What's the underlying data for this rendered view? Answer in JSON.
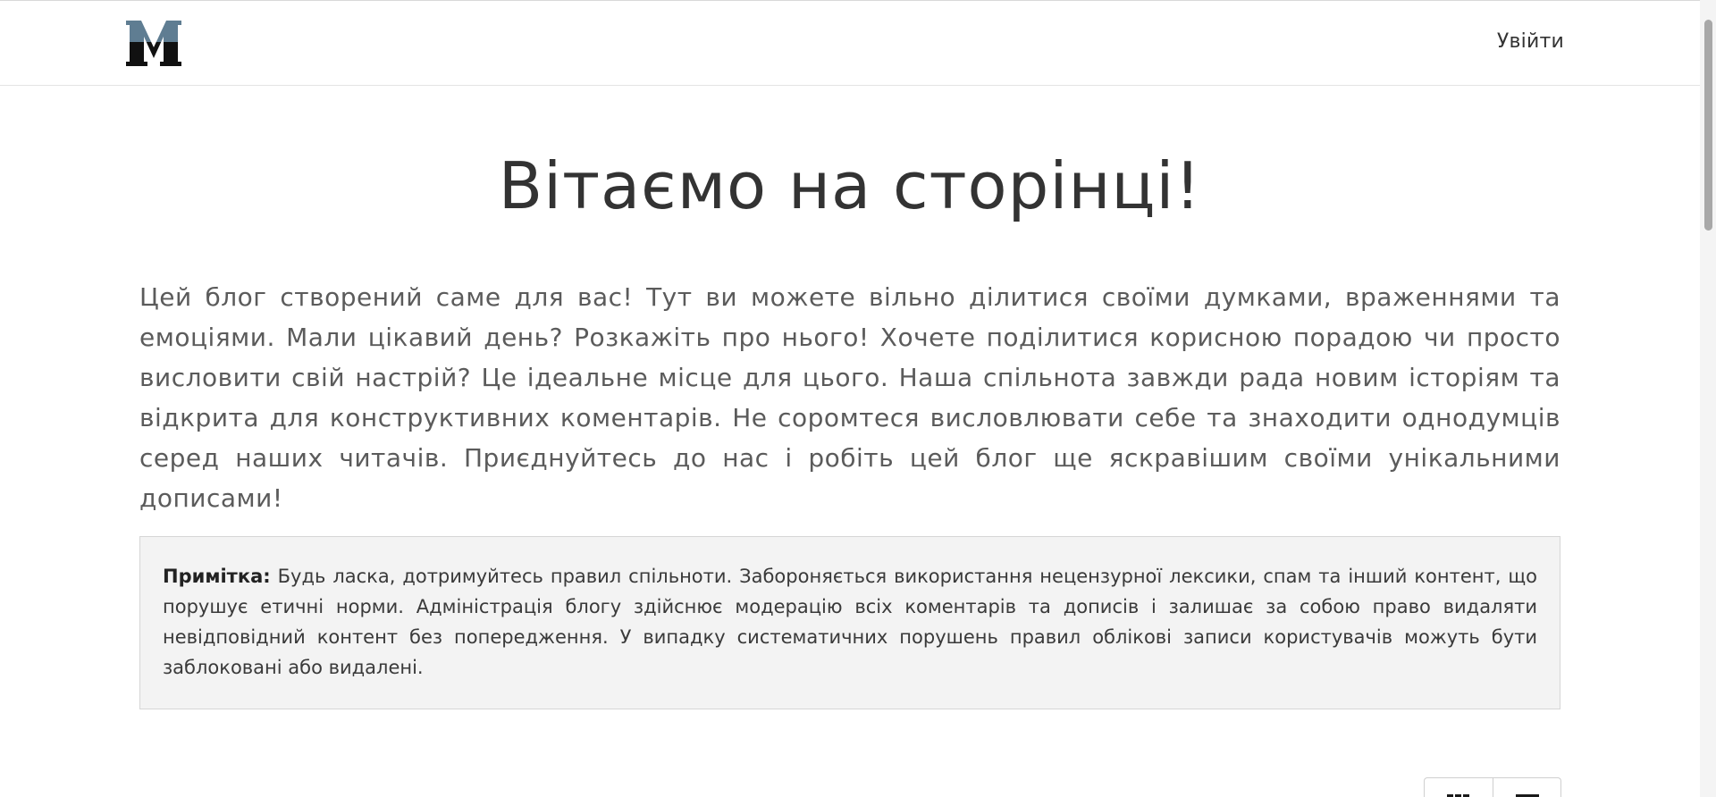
{
  "header": {
    "logo_letter": "M",
    "login_label": "Увійти"
  },
  "main": {
    "title": "Вітаємо на сторінці!",
    "intro": "Цей блог створений саме для вас! Тут ви можете вільно ділитися своїми думками, враженнями та емоціями. Мали цікавий день? Розкажіть про нього! Хочете поділитися корисною порадою чи просто висловити свій настрій? Це ідеальне місце для цього. Наша спільнота завжди рада новим історіям та відкрита для конструктивних коментарів. Не соромтеся висловлювати себе та знаходити однодумців серед наших читачів. Приєднуйтесь до нас і робіть цей блог ще яскравішим своїми унікальними дописами!",
    "note": {
      "label": "Примітка:",
      "text": "Будь ласка, дотримуйтесь правил спільноти. Забороняється використання нецензурної лексики, спам та інший контент, що порушує етичні норми. Адміністрація блогу здійснює модерацію всіх коментарів та дописів і залишає за собою право видаляти невідповідний контент без попередження. У випадку систематичних порушень правил облікові записи користувачів можуть бути заблоковані або видалені."
    }
  },
  "view_toggle": {
    "buttons": [
      {
        "icon": "grid-icon"
      },
      {
        "icon": "list-icon"
      }
    ]
  },
  "colors": {
    "logo_blue": "#5f7d92",
    "logo_dark": "#111111",
    "text_main": "#333333",
    "text_muted": "#5b5b5b",
    "note_bg": "#f3f3f3"
  }
}
